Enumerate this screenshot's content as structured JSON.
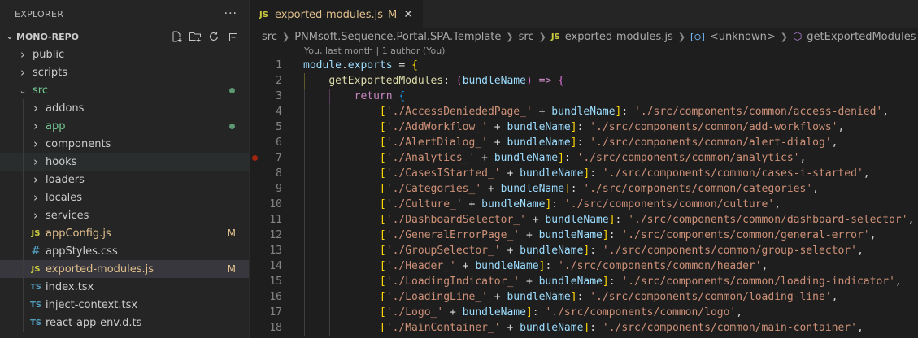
{
  "sidebar": {
    "header": "EXPLORER",
    "more_icon": "ellipsis-icon",
    "repo": "MONO-REPO",
    "actions": [
      "new-file-icon",
      "new-folder-icon",
      "refresh-icon",
      "collapse-all-icon"
    ],
    "items": [
      {
        "label": "public",
        "kind": "folder",
        "depth": 1,
        "open": false,
        "color": "#cccccc"
      },
      {
        "label": "scripts",
        "kind": "folder",
        "depth": 1,
        "open": false,
        "color": "#cccccc"
      },
      {
        "label": "src",
        "kind": "folder",
        "depth": 1,
        "open": true,
        "color": "#73c991",
        "dot": true
      },
      {
        "label": "addons",
        "kind": "folder",
        "depth": 2,
        "open": false,
        "color": "#cccccc"
      },
      {
        "label": "app",
        "kind": "folder",
        "depth": 2,
        "open": false,
        "color": "#73c991",
        "dot": true
      },
      {
        "label": "components",
        "kind": "folder",
        "depth": 2,
        "open": false,
        "color": "#cccccc"
      },
      {
        "label": "hooks",
        "kind": "folder",
        "depth": 2,
        "open": false,
        "color": "#cccccc",
        "hover": true
      },
      {
        "label": "loaders",
        "kind": "folder",
        "depth": 2,
        "open": false,
        "color": "#cccccc"
      },
      {
        "label": "locales",
        "kind": "folder",
        "depth": 2,
        "open": false,
        "color": "#cccccc"
      },
      {
        "label": "services",
        "kind": "folder",
        "depth": 2,
        "open": false,
        "color": "#cccccc"
      },
      {
        "label": "appConfig.js",
        "kind": "js",
        "depth": 2,
        "color": "#e2c08d",
        "status": "M"
      },
      {
        "label": "appStyles.css",
        "kind": "css",
        "depth": 2,
        "color": "#cccccc"
      },
      {
        "label": "exported-modules.js",
        "kind": "js",
        "depth": 2,
        "color": "#e2c08d",
        "status": "M",
        "selected": true
      },
      {
        "label": "index.tsx",
        "kind": "ts",
        "depth": 2,
        "color": "#cccccc"
      },
      {
        "label": "inject-context.tsx",
        "kind": "ts",
        "depth": 2,
        "color": "#cccccc"
      },
      {
        "label": "react-app-env.d.ts",
        "kind": "ts",
        "depth": 2,
        "color": "#cccccc"
      }
    ],
    "file_badges": {
      "js": "JS",
      "ts": "TS",
      "css": "#"
    }
  },
  "tab": {
    "badge": "JS",
    "label": "exported-modules.js",
    "status": "M",
    "close": "✕"
  },
  "breadcrumb": {
    "parts": [
      "src",
      "PNMsoft.Sequence.Portal.SPA.Template",
      "src"
    ],
    "file_badge": "JS",
    "file": "exported-modules.js",
    "symbol_icon": "variable-icon",
    "symbol": "<unknown>",
    "method_icon": "method-cube-icon",
    "method": "getExportedModules"
  },
  "codelens": "You, last month | 1 author (You)",
  "editor": {
    "entries": [
      [
        "./AccessDeniededPage_",
        "./src/components/common/access-denied"
      ],
      [
        "./AddWorkflow_",
        "./src/components/common/add-workflows"
      ],
      [
        "./AlertDialog_",
        "./src/components/common/alert-dialog"
      ],
      [
        "./Analytics_",
        "./src/components/common/analytics"
      ],
      [
        "./CasesIStarted_",
        "./src/components/common/cases-i-started"
      ],
      [
        "./Categories_",
        "./src/components/common/categories"
      ],
      [
        "./Culture_",
        "./src/components/common/culture"
      ],
      [
        "./DashboardSelector_",
        "./src/components/common/dashboard-selector"
      ],
      [
        "./GeneralErrorPage_",
        "./src/components/common/general-error"
      ],
      [
        "./GroupSelector_",
        "./src/components/common/group-selector"
      ],
      [
        "./Header_",
        "./src/components/common/header"
      ],
      [
        "./LoadingIndicator_",
        "./src/components/common/loading-indicator"
      ],
      [
        "./LoadingLine_",
        "./src/components/common/loading-line"
      ],
      [
        "./Logo_",
        "./src/components/common/logo"
      ],
      [
        "./MainContainer_",
        "./src/components/common/main-container"
      ]
    ],
    "breakpoint_line": 7,
    "first_line_number": 1
  }
}
